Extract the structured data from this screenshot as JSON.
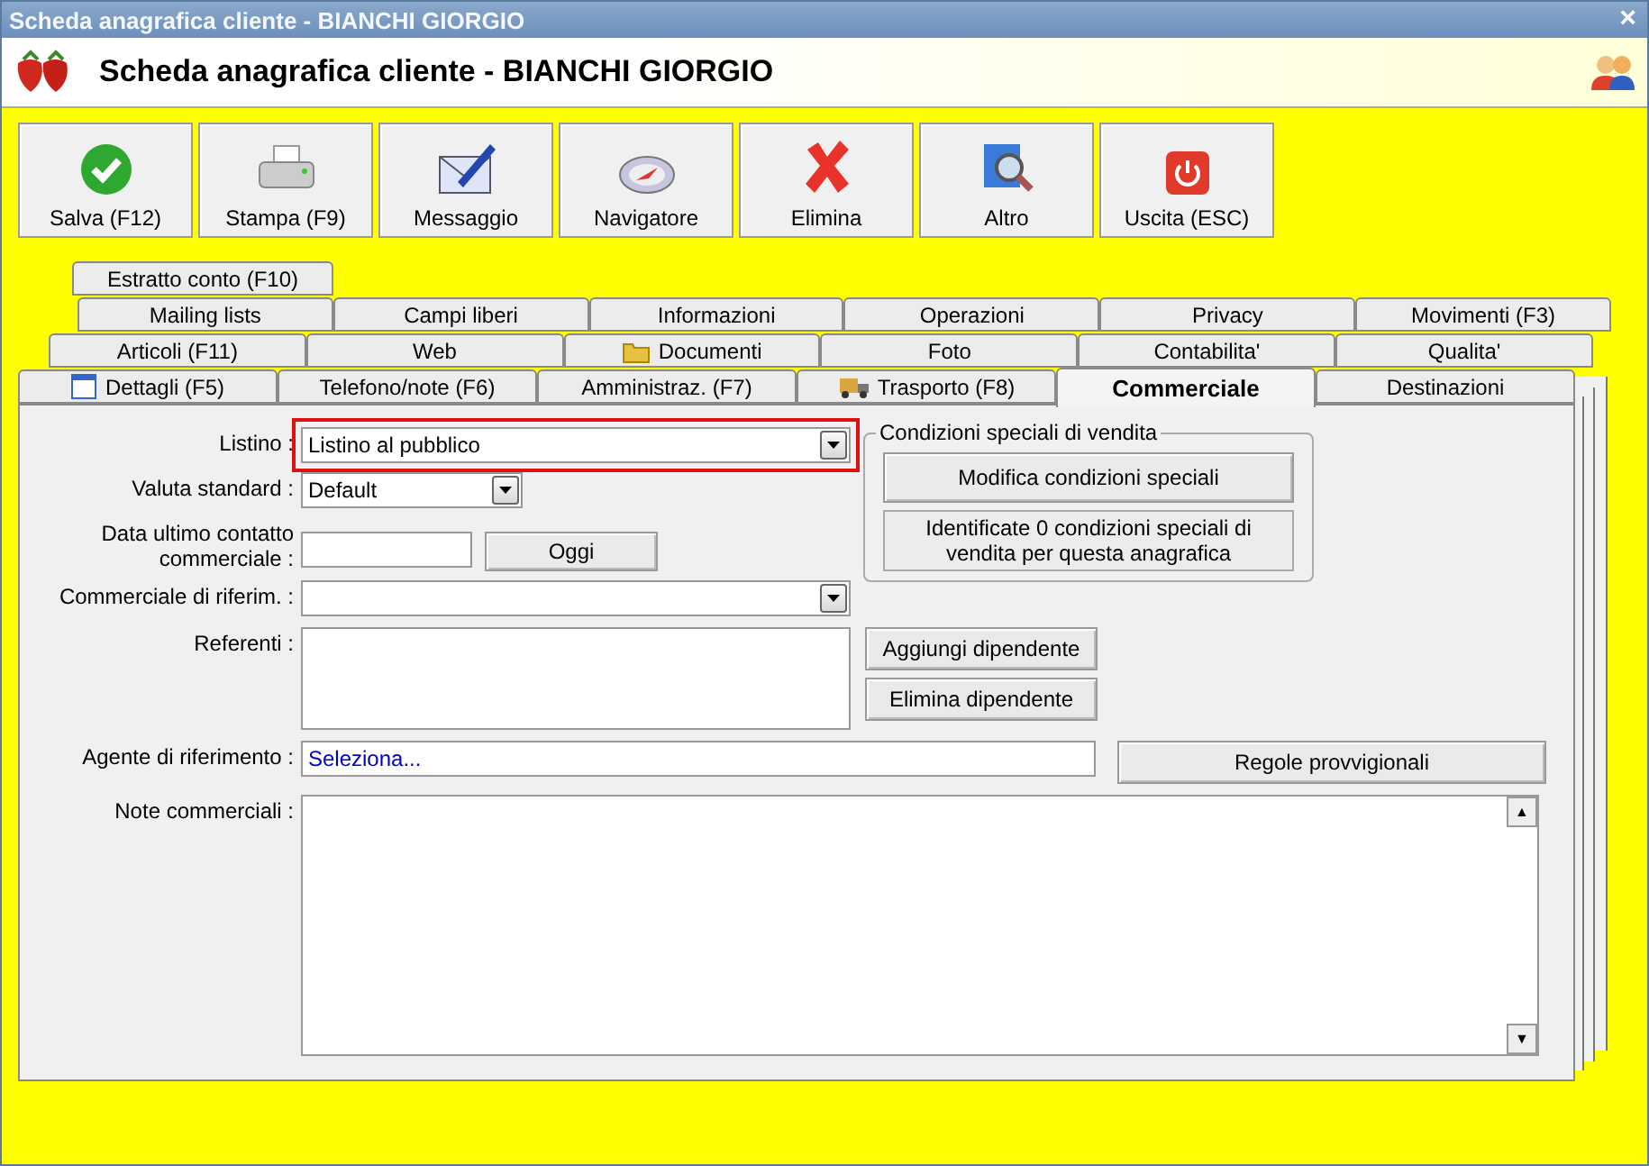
{
  "window": {
    "title": "Scheda anagrafica cliente - BIANCHI GIORGIO",
    "close": "×"
  },
  "header": {
    "title": "Scheda anagrafica cliente - BIANCHI GIORGIO"
  },
  "toolbar": [
    {
      "kind": "save",
      "label": "Salva (F12)"
    },
    {
      "kind": "print",
      "label": "Stampa (F9)"
    },
    {
      "kind": "mail",
      "label": "Messaggio"
    },
    {
      "kind": "compass",
      "label": "Navigatore"
    },
    {
      "kind": "delete",
      "label": "Elimina"
    },
    {
      "kind": "search",
      "label": "Altro"
    },
    {
      "kind": "exit",
      "label": "Uscita (ESC)"
    }
  ],
  "tab_rows": [
    [
      {
        "label": "Estratto conto (F10)",
        "selected": false
      }
    ],
    [
      {
        "label": "Mailing lists",
        "selected": false
      },
      {
        "label": "Campi liberi",
        "selected": false
      },
      {
        "label": "Informazioni",
        "selected": false
      },
      {
        "label": "Operazioni",
        "selected": false
      },
      {
        "label": "Privacy",
        "selected": false
      },
      {
        "label": "Movimenti (F3)",
        "selected": false
      }
    ],
    [
      {
        "label": "Articoli (F11)",
        "selected": false
      },
      {
        "label": "Web",
        "selected": false
      },
      {
        "label": "Documenti",
        "selected": false,
        "kind": "folder"
      },
      {
        "label": "Foto",
        "selected": false
      },
      {
        "label": "Contabilita'",
        "selected": false
      },
      {
        "label": "Qualita'",
        "selected": false
      }
    ],
    [
      {
        "label": "Dettagli (F5)",
        "selected": false,
        "kind": "calendar"
      },
      {
        "label": "Telefono/note (F6)",
        "selected": false
      },
      {
        "label": "Amministraz. (F7)",
        "selected": false
      },
      {
        "label": "Trasporto (F8)",
        "selected": false,
        "kind": "truck"
      },
      {
        "label": "Commerciale",
        "selected": true
      },
      {
        "label": "Destinazioni",
        "selected": false
      }
    ]
  ],
  "form": {
    "listino": {
      "label": "Listino :",
      "value": "Listino al pubblico",
      "highlighted": true
    },
    "valuta": {
      "label": "Valuta standard :",
      "value": "Default"
    },
    "data_contatto": {
      "label": "Data ultimo contatto commerciale :",
      "button": "Oggi"
    },
    "commerciale": {
      "label": "Commerciale di riferim. :"
    },
    "referenti": {
      "label": "Referenti :",
      "buttons": [
        "Aggiungi dipendente",
        "Elimina dipendente"
      ]
    },
    "agente": {
      "label": "Agente di riferimento :",
      "value": "Seleziona...",
      "button": "Regole provvigionali"
    },
    "note": {
      "label": "Note commerciali :",
      "scroll_up": "▲",
      "scroll_down": "▼"
    }
  },
  "condizioni": {
    "title": "Condizioni speciali di vendita",
    "button": "Modifica condizioni speciali",
    "info": "Identificate 0 condizioni speciali di vendita per questa anagrafica"
  }
}
